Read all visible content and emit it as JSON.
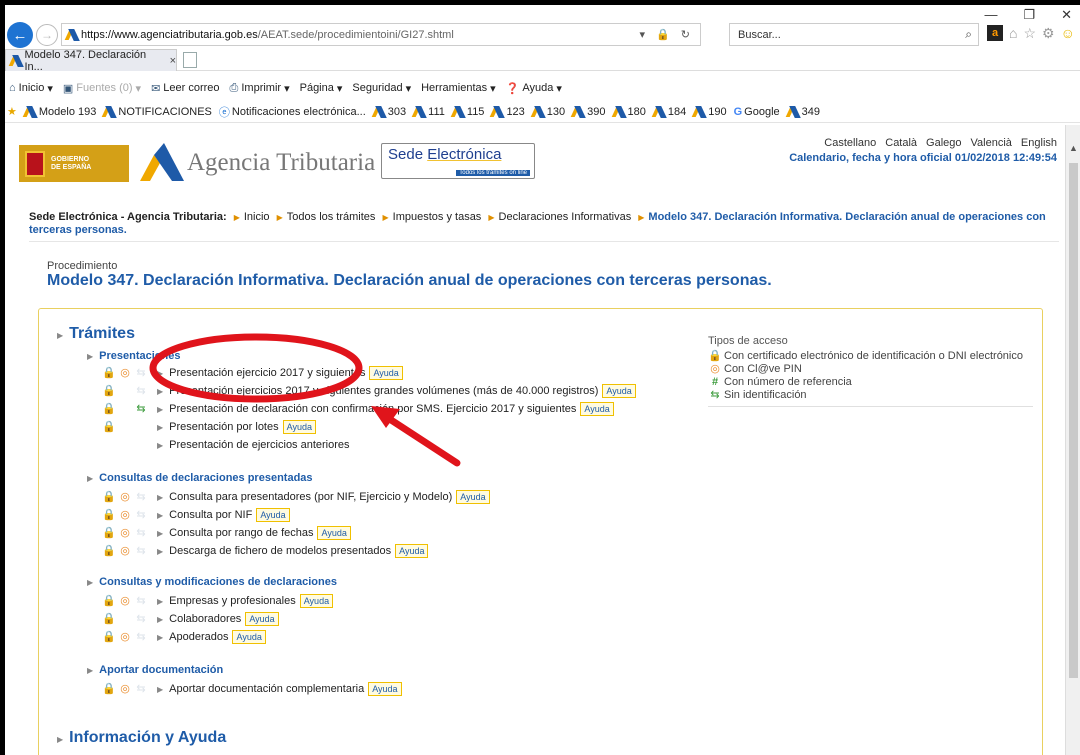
{
  "browser": {
    "url_bold": "https://www.agenciatributaria.gob.es",
    "url_rest": "/AEAT.sede/procedimientoini/GI27.shtml",
    "url_icons": "▾ 🔒 ↻",
    "search_placeholder": "Buscar...",
    "tab_title": "Modelo 347. Declaración In...",
    "tab_close": "×",
    "win_minimize": "—",
    "win_maximize": "❐",
    "win_close": "✕",
    "back_glyph": "←",
    "forward_glyph": "→"
  },
  "command_bar": {
    "home": "Inicio",
    "feeds": "Fuentes (0)",
    "mail": "Leer correo",
    "print": "Imprimir",
    "page": "Página",
    "security": "Seguridad",
    "tools": "Herramientas",
    "help": "Ayuda"
  },
  "favorites": [
    "Modelo 193",
    "NOTIFICACIONES",
    "Notificaciones electrónica...",
    "303",
    "111",
    "115",
    "123",
    "130",
    "390",
    "180",
    "184",
    "190",
    "Google",
    "349"
  ],
  "header": {
    "languages": [
      "Castellano",
      "Català",
      "Galego",
      "Valencià",
      "English"
    ],
    "official_time": "Calendario, fecha y hora oficial 01/02/2018 12:49:54",
    "gob_line1": "GOBIERNO",
    "gob_line2": "DE ESPAÑA",
    "agency_name": "Agencia Tributaria",
    "sede_title_a": "Sede ",
    "sede_title_b": "Electrónica",
    "sede_subtitle": "Todos los trámites on line"
  },
  "breadcrumb": {
    "first": "Sede Electrónica - Agencia Tributaria:",
    "items": [
      "Inicio",
      "Todos los trámites",
      "Impuestos y tasas",
      "Declaraciones Informativas"
    ],
    "current": "Modelo 347. Declaración Informativa. Declaración anual de operaciones con terceras personas."
  },
  "procedure": {
    "label": "Procedimiento",
    "title": "Modelo 347. Declaración Informativa. Declaración anual de operaciones con terceras personas."
  },
  "tramites": {
    "heading": "Trámites",
    "ayuda_label": "Ayuda",
    "presentaciones": {
      "heading": "Presentaciones",
      "items": [
        "Presentación ejercicio 2017 y siguientes",
        "Presentación ejercicios 2017 y siguientes grandes volúmenes (más de 40.000 registros)",
        "Presentación de declaración con confirmación por SMS. Ejercicio 2017 y siguientes",
        "Presentación por lotes",
        "Presentación de ejercicios anteriores"
      ]
    },
    "consultas": {
      "heading": "Consultas de declaraciones presentadas",
      "items": [
        "Consulta para presentadores (por NIF, Ejercicio y Modelo)",
        "Consulta por NIF",
        "Consulta por rango de fechas",
        "Descarga de fichero de modelos presentados"
      ]
    },
    "modificaciones": {
      "heading": "Consultas y modificaciones de declaraciones",
      "items": [
        "Empresas y profesionales",
        "Colaboradores",
        "Apoderados"
      ]
    },
    "aportar": {
      "heading": "Aportar documentación",
      "items": [
        "Aportar documentación complementaria"
      ]
    }
  },
  "info_heading": "Información y Ayuda",
  "access_legend": {
    "title": "Tipos de acceso",
    "items": [
      "Con certificado electrónico de identificación o DNI electrónico",
      "Con Cl@ve PIN",
      "Con número de referencia",
      "Sin identificación"
    ]
  },
  "icons": {
    "lock": "lock-icon",
    "clave": "clave-pin-icon",
    "reference": "reference-number-icon",
    "sms": "no-identification-icon"
  },
  "colors": {
    "link_blue": "#1f5ca8",
    "annotation_red": "#e0141b",
    "box_border": "#e9d060"
  }
}
